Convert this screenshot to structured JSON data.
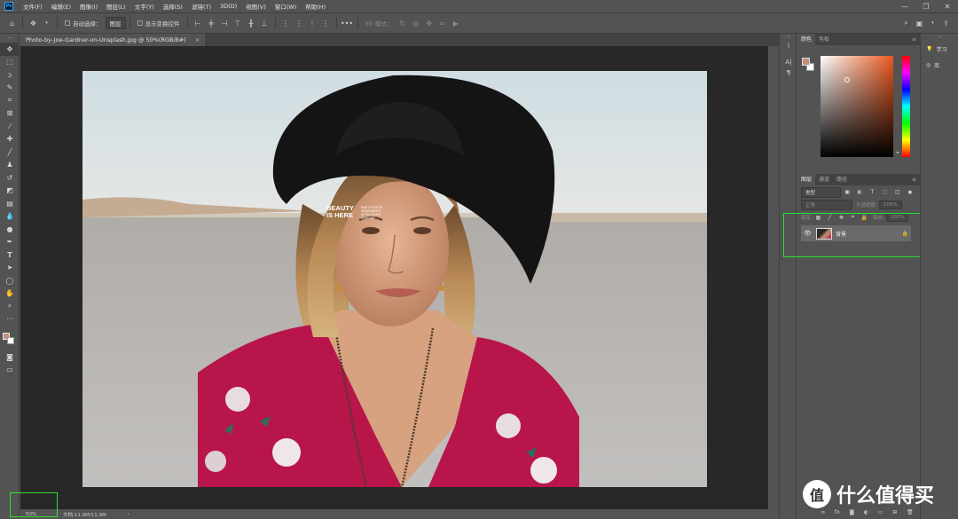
{
  "menubar": {
    "logo_text": "Ps",
    "items": [
      "文件(F)",
      "编辑(E)",
      "图像(I)",
      "图层(L)",
      "文字(Y)",
      "选择(S)",
      "滤镜(T)",
      "3D(D)",
      "视图(V)",
      "窗口(W)",
      "帮助(H)"
    ],
    "window_controls": [
      "—",
      "❐",
      "✕"
    ]
  },
  "options_bar": {
    "auto_select_label": "自动选择：",
    "auto_select_value": "图层",
    "show_transform_label": "显示变换控件",
    "mode_3d_label": "3D 模式："
  },
  "document": {
    "tab_title": "Photo-by-Joe-Gardner-on-Unsplash.jpg @ 50%(RGB/8#)",
    "tab_close": "×",
    "photo_text_big_1": "BEAUTY",
    "photo_text_big_2": "IS HERE",
    "photo_text_small": [
      "PAINT IT MATTE",
      "SHINE BRIGHT",
      "ULTRA TOUCH",
      "PERFUME"
    ]
  },
  "statusbar": {
    "zoom": "50%",
    "doc_info": "文档:11.9M/11.9M",
    "arrow": "›"
  },
  "color_panel": {
    "tabs": [
      "颜色",
      "色板"
    ],
    "foreground_color": "#c39079",
    "hue_base": "#e9581f"
  },
  "layers_panel": {
    "tabs": [
      "图层",
      "通道",
      "路径"
    ],
    "filter_label": "类型",
    "blend_mode": "正常",
    "opacity_label": "不透明度:",
    "opacity_value": "100%",
    "lock_label": "锁定:",
    "fill_label": "填充:",
    "fill_value": "100%",
    "layers": [
      {
        "name": "背景",
        "locked": true,
        "visible": true
      }
    ]
  },
  "right_column": {
    "items": [
      "学习",
      "库"
    ]
  },
  "watermark": {
    "text": "什么值得买"
  },
  "colors": {
    "accent_green": "#2ee02e",
    "ps_blue": "#31a8ff",
    "shirt_red": "#b8164b"
  }
}
